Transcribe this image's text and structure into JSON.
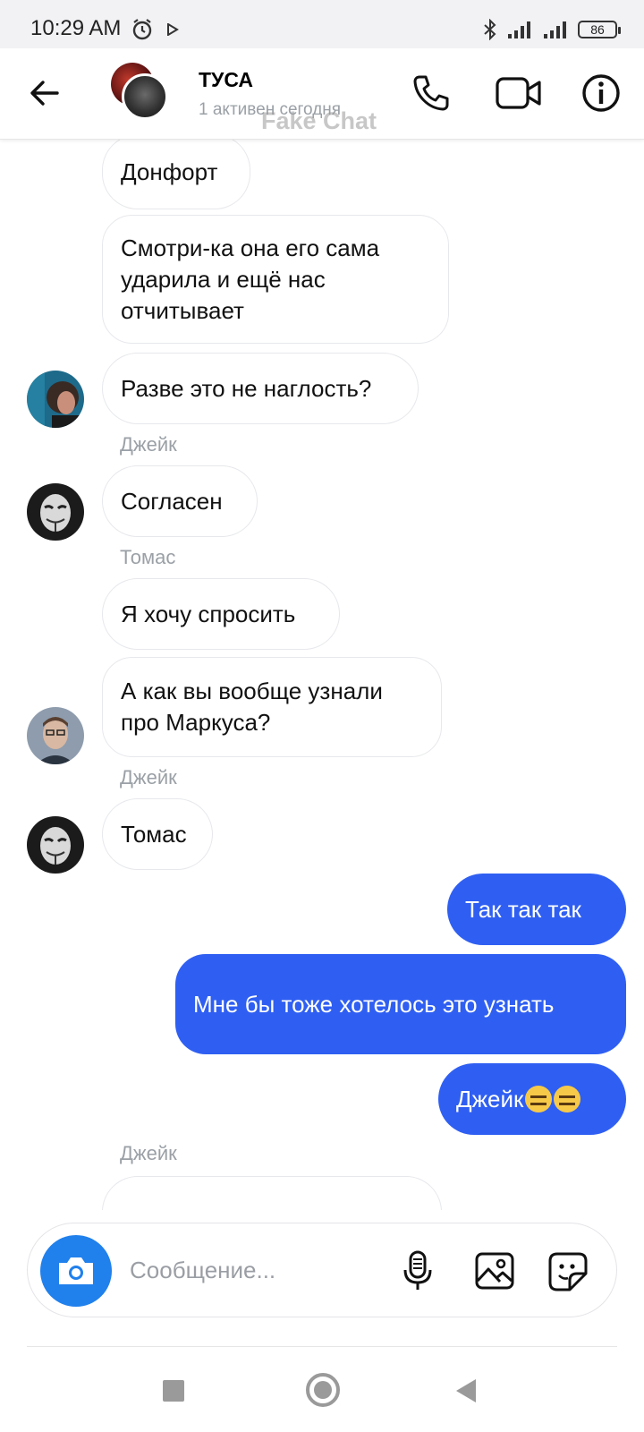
{
  "status_bar": {
    "time": "10:29 AM",
    "battery": "86"
  },
  "header": {
    "title": "ТУСА",
    "subtitle": "1 активен сегодня",
    "watermark": "Fake Chat"
  },
  "messages": [
    {
      "text": "Донфорт"
    },
    {
      "text": "Смотри-ка она его сама ударила и ещё нас отчитывает"
    },
    {
      "text": "Разве это не наглость?"
    },
    {
      "sender": "Джейк"
    },
    {
      "text": "Согласен"
    },
    {
      "sender": "Томас"
    },
    {
      "text": "Я хочу спросить"
    },
    {
      "text": "А как вы вообще узнали про Маркуса?"
    },
    {
      "sender": "Джейк"
    },
    {
      "text": "Томас"
    },
    {
      "text": "Так так так"
    },
    {
      "text": "Мне бы тоже хотелось это узнать"
    },
    {
      "text": "Джейк",
      "emoji": [
        "expressionless-face",
        "expressionless-face"
      ]
    },
    {
      "sender": "Джейк"
    }
  ],
  "composer": {
    "placeholder": "Сообщение..."
  },
  "colors": {
    "outgoing_bubble": "#2f5ff2",
    "camera_button": "#2080ec",
    "incoming_border": "#e7e8ec"
  }
}
